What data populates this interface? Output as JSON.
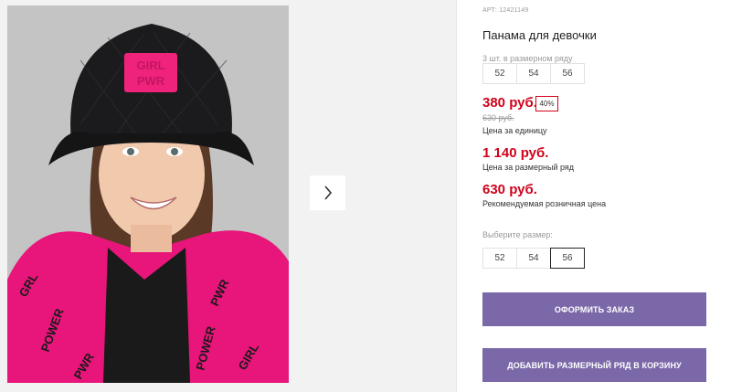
{
  "product": {
    "article": "АРТ: 12421149",
    "title": "Панама для девочки"
  },
  "size_row_info": {
    "note": "3 шт. в размерном ряду",
    "sizes": [
      "52",
      "54",
      "56"
    ]
  },
  "pricing": {
    "unit_price": "380 руб.",
    "discount": "40%",
    "old_price": "630 руб.",
    "unit_label": "Цена за единицу",
    "row_price": "1 140 руб.",
    "row_label": "Цена за размерный ряд",
    "rrp_price": "630 руб.",
    "rrp_label": "Рекомендуемая розничная цена"
  },
  "size_select": {
    "label": "Выберите размер:",
    "options": [
      "52",
      "54",
      "56"
    ],
    "selected": "56"
  },
  "actions": {
    "order_label": "ОФОРМИТЬ ЗАКАЗ",
    "add_row_label": "ДОБАВИТЬ РАЗМЕРНЫЙ РЯД В КОРЗИНУ"
  },
  "gallery": {
    "next_icon": "chevron-right-icon",
    "hat_patch_text": [
      "GIRL",
      "PWR"
    ]
  },
  "colors": {
    "price_red": "#d0021b",
    "button_purple": "#7b68a8"
  }
}
